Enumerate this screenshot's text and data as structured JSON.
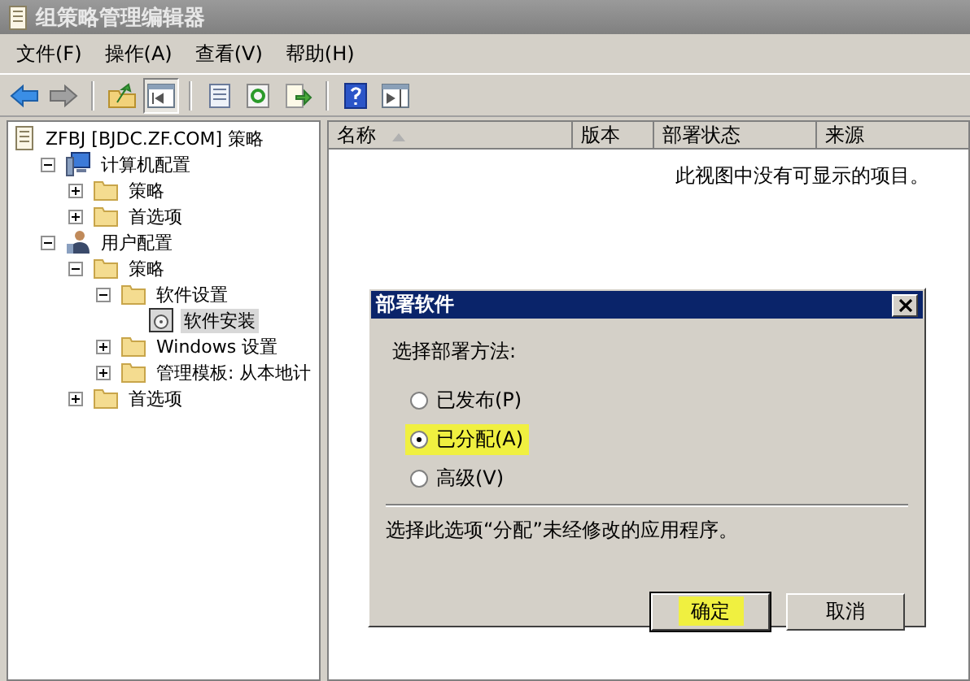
{
  "window": {
    "title": "组策略管理编辑器"
  },
  "menu": [
    "文件(F)",
    "操作(A)",
    "查看(V)",
    "帮助(H)"
  ],
  "toolbar": [
    {
      "kind": "back",
      "pressed": false
    },
    {
      "kind": "forward",
      "pressed": false
    },
    {
      "kind": "sep"
    },
    {
      "kind": "up",
      "pressed": false
    },
    {
      "kind": "tree",
      "pressed": true
    },
    {
      "kind": "sep"
    },
    {
      "kind": "props",
      "pressed": false
    },
    {
      "kind": "refresh",
      "pressed": false
    },
    {
      "kind": "export",
      "pressed": false
    },
    {
      "kind": "sep"
    },
    {
      "kind": "help",
      "pressed": false
    },
    {
      "kind": "pane",
      "pressed": false
    }
  ],
  "tree": [
    {
      "label": "ZFBJ [BJDC.ZF.COM] 策略",
      "kind": "document",
      "selected": false,
      "children": [
        {
          "label": "计算机配置",
          "kind": "computer",
          "expanded": true,
          "selected": false,
          "children": [
            {
              "label": "策略",
              "kind": "folder",
              "expanded": false,
              "selected": false
            },
            {
              "label": "首选项",
              "kind": "folder",
              "expanded": false,
              "selected": false
            }
          ]
        },
        {
          "label": "用户配置",
          "kind": "user",
          "expanded": true,
          "selected": false,
          "children": [
            {
              "label": "策略",
              "kind": "folder",
              "expanded": true,
              "selected": false,
              "children": [
                {
                  "label": "软件设置",
                  "kind": "folder",
                  "expanded": true,
                  "selected": false,
                  "children": [
                    {
                      "label": "软件安装",
                      "kind": "package",
                      "selected": true
                    }
                  ]
                },
                {
                  "label": "Windows 设置",
                  "kind": "folder",
                  "expanded": false,
                  "selected": false
                },
                {
                  "label": "管理模板: 从本地计",
                  "kind": "folder",
                  "expanded": false,
                  "selected": false
                }
              ]
            },
            {
              "label": "首选项",
              "kind": "folder",
              "expanded": false,
              "selected": false
            }
          ]
        }
      ]
    }
  ],
  "list": {
    "columns": [
      {
        "label": "名称",
        "sorted": true
      },
      {
        "label": "版本",
        "sorted": false
      },
      {
        "label": "部署状态",
        "sorted": false
      },
      {
        "label": "来源",
        "sorted": false
      }
    ],
    "empty_message": "此视图中没有可显示的项目。"
  },
  "dialog": {
    "title": "部署软件",
    "prompt": "选择部署方法:",
    "options": [
      {
        "label": "已发布(P)",
        "selected": false,
        "highlighted": false
      },
      {
        "label": "已分配(A)",
        "selected": true,
        "highlighted": true
      },
      {
        "label": "高级(V)",
        "selected": false,
        "highlighted": false
      }
    ],
    "description": "选择此选项“分配”未经修改的应用程序。",
    "buttons": [
      {
        "label": "确定",
        "default": true,
        "highlighted": true
      },
      {
        "label": "取消",
        "default": false,
        "highlighted": false
      }
    ]
  }
}
